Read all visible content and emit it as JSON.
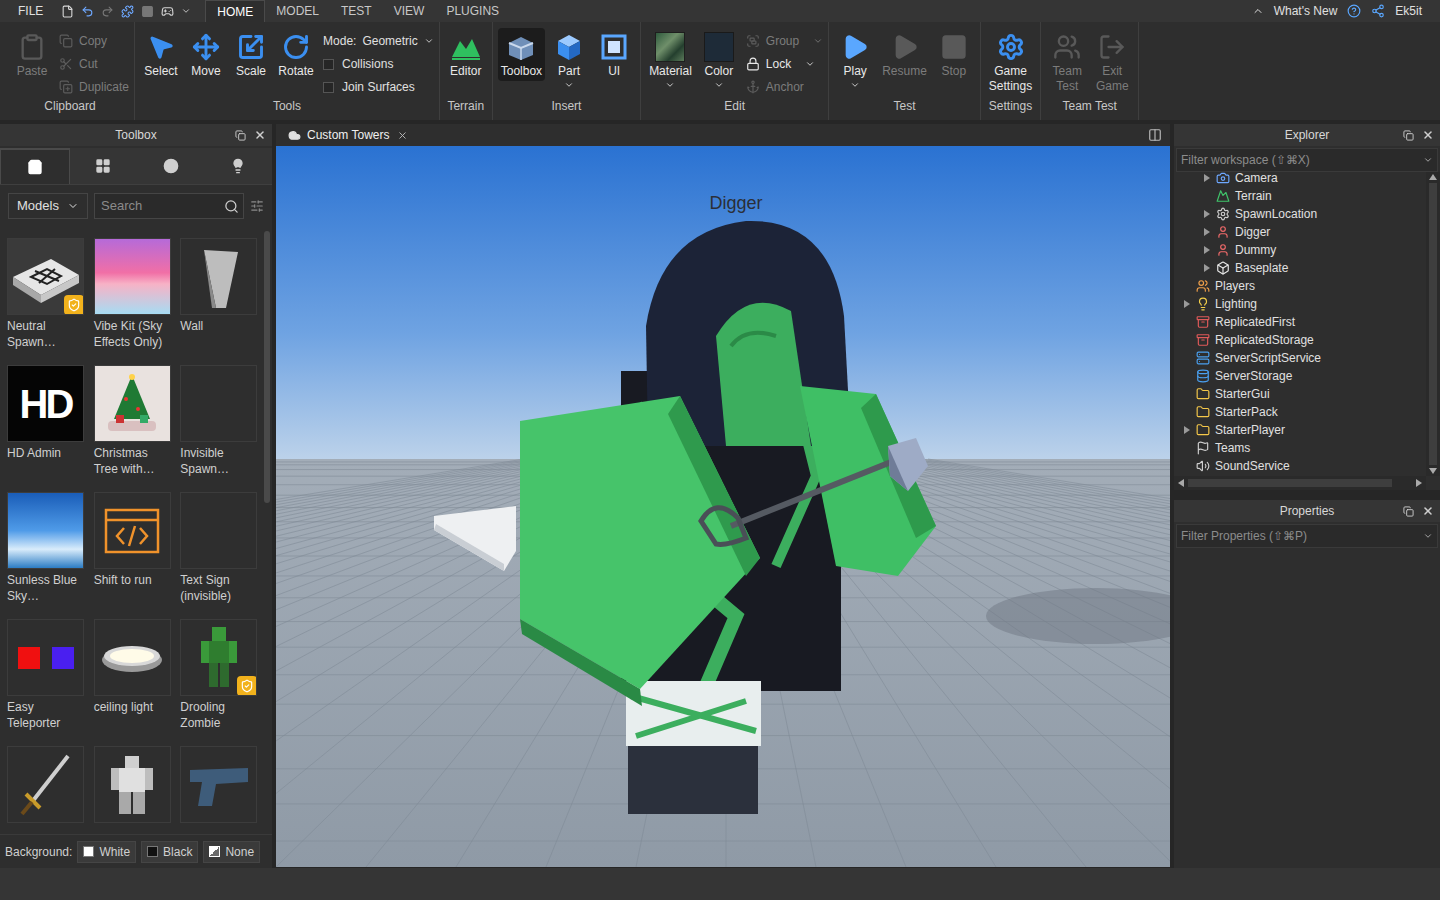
{
  "menu_bar": {
    "file": "FILE",
    "tabs": [
      {
        "label": "HOME",
        "selected": true
      },
      {
        "label": "MODEL",
        "selected": false
      },
      {
        "label": "TEST",
        "selected": false
      },
      {
        "label": "VIEW",
        "selected": false
      },
      {
        "label": "PLUGINS",
        "selected": false
      }
    ],
    "whats_new": "What's New",
    "user": "Ek5it"
  },
  "ribbon": [
    {
      "label": "Clipboard",
      "items": [
        {
          "label": "Paste",
          "kind": "large",
          "disabled": true,
          "selected": false,
          "dropdown": false
        },
        {
          "label": "Copy",
          "kind": "small",
          "disabled": true,
          "selected": false,
          "dropdown": false
        },
        {
          "label": "Cut",
          "kind": "small",
          "disabled": true,
          "selected": false,
          "dropdown": false
        },
        {
          "label": "Duplicate",
          "kind": "small",
          "disabled": true,
          "selected": false,
          "dropdown": false
        }
      ]
    },
    {
      "label": "Tools",
      "items": [
        {
          "label": "Select",
          "kind": "large",
          "disabled": false,
          "selected": false,
          "dropdown": false
        },
        {
          "label": "Move",
          "kind": "large",
          "disabled": false,
          "selected": false,
          "dropdown": false
        },
        {
          "label": "Scale",
          "kind": "large",
          "disabled": false,
          "selected": false,
          "dropdown": false
        },
        {
          "label": "Rotate",
          "kind": "large",
          "disabled": false,
          "selected": false,
          "dropdown": false
        },
        {
          "label": "Mode:",
          "kind": "mode",
          "value": "Geometric",
          "disabled": false,
          "selected": false,
          "dropdown": true
        },
        {
          "label": "Collisions",
          "kind": "check",
          "checked": false,
          "disabled": false,
          "selected": false,
          "dropdown": false
        },
        {
          "label": "Join Surfaces",
          "kind": "check",
          "checked": false,
          "disabled": false,
          "selected": false,
          "dropdown": false
        }
      ]
    },
    {
      "label": "Terrain",
      "items": [
        {
          "label": "Editor",
          "kind": "large",
          "disabled": false,
          "selected": false,
          "dropdown": false
        }
      ]
    },
    {
      "label": "Insert",
      "items": [
        {
          "label": "Toolbox",
          "kind": "large",
          "disabled": false,
          "selected": true,
          "dropdown": false
        },
        {
          "label": "Part",
          "kind": "large",
          "disabled": false,
          "selected": false,
          "dropdown": true
        },
        {
          "label": "UI",
          "kind": "large",
          "disabled": false,
          "selected": false,
          "dropdown": false
        }
      ]
    },
    {
      "label": "Edit",
      "items": [
        {
          "label": "Material",
          "kind": "large",
          "disabled": false,
          "selected": false,
          "dropdown": true
        },
        {
          "label": "Color",
          "kind": "large",
          "disabled": false,
          "selected": false,
          "dropdown": true
        },
        {
          "label": "Group",
          "kind": "small",
          "disabled": true,
          "selected": false,
          "dropdown": true
        },
        {
          "label": "Lock",
          "kind": "small",
          "disabled": false,
          "selected": false,
          "dropdown": true
        },
        {
          "label": "Anchor",
          "kind": "small",
          "disabled": true,
          "selected": false,
          "dropdown": false
        }
      ]
    },
    {
      "label": "Test",
      "items": [
        {
          "label": "Play",
          "kind": "large",
          "disabled": false,
          "selected": false,
          "dropdown": true
        },
        {
          "label": "Resume",
          "kind": "large",
          "disabled": true,
          "selected": false,
          "dropdown": false
        },
        {
          "label": "Stop",
          "kind": "large",
          "disabled": true,
          "selected": false,
          "dropdown": false
        }
      ]
    },
    {
      "label": "Settings",
      "items": [
        {
          "label": "Game Settings",
          "kind": "large",
          "disabled": false,
          "selected": false,
          "dropdown": false
        }
      ]
    },
    {
      "label": "Team Test",
      "items": [
        {
          "label": "Team Test",
          "kind": "large",
          "disabled": true,
          "selected": false,
          "dropdown": false
        },
        {
          "label": "Exit Game",
          "kind": "large",
          "disabled": true,
          "selected": false,
          "dropdown": false
        }
      ]
    }
  ],
  "toolbox": {
    "title": "Toolbox",
    "tabs": [
      {
        "selected": true
      },
      {
        "selected": false
      },
      {
        "selected": false
      },
      {
        "selected": false
      }
    ],
    "category": "Models",
    "search_placeholder": "Search",
    "items": [
      {
        "label": "Neutral Spawn…",
        "verified": true
      },
      {
        "label": "Vibe Kit (Sky Effects Only)",
        "verified": false
      },
      {
        "label": "Wall",
        "verified": false
      },
      {
        "label": "HD Admin",
        "verified": false,
        "thumbnail_text": "HD"
      },
      {
        "label": "Christmas Tree with…",
        "verified": false
      },
      {
        "label": "Invisible Spawn…",
        "verified": false
      },
      {
        "label": "Sunless Blue Sky…",
        "verified": false
      },
      {
        "label": "Shift to run",
        "verified": false
      },
      {
        "label": "Text Sign (invisible)",
        "verified": false
      },
      {
        "label": "Easy Teleporter",
        "verified": false
      },
      {
        "label": "ceiling light",
        "verified": false
      },
      {
        "label": "Drooling Zombie",
        "verified": true
      },
      {
        "verified": false
      },
      {
        "verified": false
      },
      {
        "verified": false
      }
    ],
    "background": {
      "label": "Background:",
      "options": [
        {
          "label": "White",
          "kind": "solid",
          "color": "#ffffff"
        },
        {
          "label": "Black",
          "kind": "solid",
          "color": "#111111"
        },
        {
          "label": "None",
          "kind": "none",
          "color": "#ffffff"
        }
      ]
    }
  },
  "viewport": {
    "tab": "Custom Towers",
    "name_tag": "Digger"
  },
  "explorer": {
    "title": "Explorer",
    "filter": "Filter workspace (⇧⌘X)",
    "items": [
      {
        "label": "Camera",
        "level": 1,
        "expandable": true,
        "expanded": false
      },
      {
        "label": "Terrain",
        "level": 1,
        "expandable": false,
        "expanded": false
      },
      {
        "label": "SpawnLocation",
        "level": 1,
        "expandable": true,
        "expanded": false
      },
      {
        "label": "Digger",
        "level": 1,
        "expandable": true,
        "expanded": false
      },
      {
        "label": "Dummy",
        "level": 1,
        "expandable": true,
        "expanded": false
      },
      {
        "label": "Baseplate",
        "level": 1,
        "expandable": true,
        "expanded": false
      },
      {
        "label": "Players",
        "level": 0,
        "expandable": false,
        "expanded": false
      },
      {
        "label": "Lighting",
        "level": 0,
        "expandable": true,
        "expanded": false
      },
      {
        "label": "ReplicatedFirst",
        "level": 0,
        "expandable": false,
        "expanded": false
      },
      {
        "label": "ReplicatedStorage",
        "level": 0,
        "expandable": false,
        "expanded": false
      },
      {
        "label": "ServerScriptService",
        "level": 0,
        "expandable": false,
        "expanded": false
      },
      {
        "label": "ServerStorage",
        "level": 0,
        "expandable": false,
        "expanded": false
      },
      {
        "label": "StarterGui",
        "level": 0,
        "expandable": false,
        "expanded": false
      },
      {
        "label": "StarterPack",
        "level": 0,
        "expandable": false,
        "expanded": false
      },
      {
        "label": "StarterPlayer",
        "level": 0,
        "expandable": true,
        "expanded": false
      },
      {
        "label": "Teams",
        "level": 0,
        "expandable": false,
        "expanded": false
      },
      {
        "label": "SoundService",
        "level": 0,
        "expandable": false,
        "expanded": false
      }
    ]
  },
  "properties": {
    "title": "Properties",
    "filter": "Filter Properties (⇧⌘P)"
  }
}
